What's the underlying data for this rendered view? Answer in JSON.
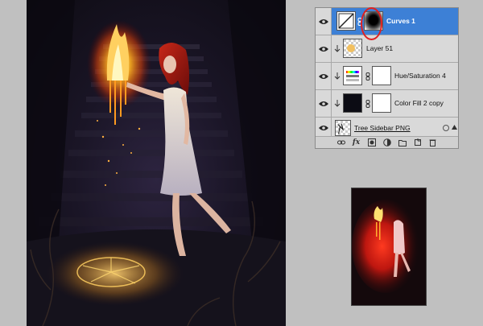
{
  "canvas": {
    "description": "photo manipulation artwork"
  },
  "layers_panel": {
    "layers": [
      {
        "name": "Curves 1",
        "type": "adjustment-curves",
        "selected": true,
        "has_mask": true
      },
      {
        "name": "Layer 51",
        "type": "pixel",
        "clipped": true
      },
      {
        "name": "Hue/Saturation 4",
        "type": "adjustment-hue-saturation",
        "clipped": true
      },
      {
        "name": "Color Fill 2 copy",
        "type": "color-fill",
        "clipped": true
      },
      {
        "name": "Tree Sidebar PNG",
        "type": "pixel"
      }
    ],
    "footer_icons": [
      "link-icon",
      "fx-icon",
      "mask-icon",
      "adjustment-icon",
      "folder-icon",
      "new-layer-icon",
      "trash-icon"
    ],
    "footer_fx_label": "fx"
  },
  "colors": {
    "selected": "#3d80d6",
    "highlight": "#e02020",
    "panel_bg": "#d6d6d6",
    "fill_swatch": "#0c0c14"
  }
}
